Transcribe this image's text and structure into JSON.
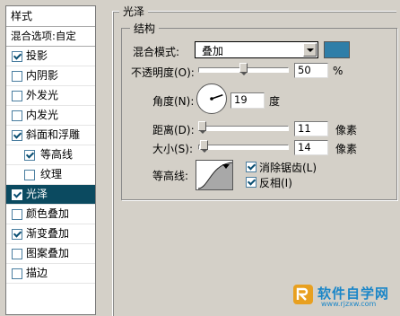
{
  "style_list": {
    "header": "样式",
    "blend_options": "混合选项:自定",
    "items": [
      {
        "label": "投影",
        "checked": true,
        "level": 0
      },
      {
        "label": "内阴影",
        "checked": false,
        "level": 0
      },
      {
        "label": "外发光",
        "checked": false,
        "level": 0
      },
      {
        "label": "内发光",
        "checked": false,
        "level": 0
      },
      {
        "label": "斜面和浮雕",
        "checked": true,
        "level": 0
      },
      {
        "label": "等高线",
        "checked": true,
        "level": 1
      },
      {
        "label": "纹理",
        "checked": false,
        "level": 1
      },
      {
        "label": "光泽",
        "checked": true,
        "level": 0,
        "selected": true
      },
      {
        "label": "颜色叠加",
        "checked": false,
        "level": 0
      },
      {
        "label": "渐变叠加",
        "checked": true,
        "level": 0
      },
      {
        "label": "图案叠加",
        "checked": false,
        "level": 0
      },
      {
        "label": "描边",
        "checked": false,
        "level": 0
      }
    ]
  },
  "panel": {
    "group_title": "光泽",
    "structure_title": "结构",
    "blend_mode_label": "混合模式:",
    "blend_mode_value": "叠加",
    "blend_color": "#2f7ea8",
    "opacity_label": "不透明度(O):",
    "opacity_value": "50",
    "opacity_unit": "%",
    "opacity_level": 50,
    "angle_label": "角度(N):",
    "angle_value": "19",
    "angle_unit": "度",
    "distance_label": "距离(D):",
    "distance_value": "11",
    "distance_unit": "像素",
    "distance_level": 4.4,
    "size_label": "大小(S):",
    "size_value": "14",
    "size_unit": "像素",
    "size_level": 5.6,
    "contour_label": "等高线:",
    "antialias_label": "消除锯齿(L)",
    "antialias_checked": true,
    "invert_label": "反相(I)",
    "invert_checked": true
  },
  "watermark": {
    "text": "软件自学网",
    "url": "www.rjzxw.com"
  }
}
